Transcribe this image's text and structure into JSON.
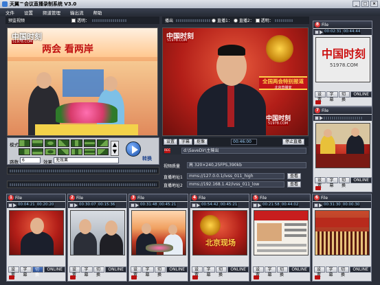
{
  "window": {
    "title": "天翼™会议直播录制系统 V3.0"
  },
  "menu": [
    "文件",
    "设置",
    "频道管理",
    "输出流",
    "帮助"
  ],
  "preview_bar": {
    "label": "预监视频",
    "transparency_label": "透明："
  },
  "output_bar": {
    "label": "播出",
    "live1": "直播1：",
    "live2": "直播2：",
    "transparency_label": "透明："
  },
  "preview_video": {
    "channel_logo": "中国时刻",
    "channel_url": "51978.COM",
    "caption": "两会 看两岸"
  },
  "transition": {
    "mode_label": "模式",
    "route_label": "路数",
    "route_value": "6",
    "effect_label": "效果",
    "effect_value": "无效果",
    "switch_label": "转换"
  },
  "program": {
    "channel_logo": "中国时刻",
    "channel_url": "51978.COM",
    "banner": "全国两会特别报道",
    "banner_sub": "北京直播室",
    "buttons": [
      "设置",
      "字幕",
      "抠像"
    ],
    "timecode": "00:46:00",
    "stop_label": "停止直播",
    "rec_label": "REC",
    "save_path": "d:\\SaveDir\\主输出",
    "quality_label": "视频质量",
    "quality_value": "高 320×240,25FPS,390kb",
    "live_addr1_label": "直播地址1",
    "live_addr1": "mms://127.0.0.1/ivss_011_high",
    "live_addr2_label": "直播地址2",
    "live_addr2": "mms://192.168.1.42/ivss_011_low",
    "view_label": "查看"
  },
  "right_cams": [
    {
      "num": "8",
      "label": "File",
      "t1": "00:02:31",
      "t2": "00:44:44",
      "logo": "中国时刻",
      "url": "51978.COM"
    },
    {
      "num": "7",
      "label": "File",
      "t1": "",
      "t2": "",
      "logo": "",
      "url": ""
    }
  ],
  "bottom_cams": [
    {
      "num": "1",
      "label": "File",
      "t1": "00:04:21",
      "t2": "00:20:20"
    },
    {
      "num": "2",
      "label": "File",
      "t1": "00:30:07",
      "t2": "00:15:36"
    },
    {
      "num": "3",
      "label": "File",
      "t1": "00:31:48",
      "t2": "00:45:21"
    },
    {
      "num": "4",
      "label": "File",
      "t1": "00:54:42",
      "t2": "00:45:21"
    },
    {
      "num": "5",
      "label": "File",
      "t1": "00:21:58",
      "t2": "00:44:02"
    },
    {
      "num": "6",
      "label": "File",
      "t1": "00:31:30",
      "t2": "00:00:30"
    }
  ],
  "cam_buttons": [
    "设置",
    "字幕",
    "切换",
    "ONLINE"
  ],
  "cam4_caption": "北京现场",
  "colors": {
    "accent": "#2a4d8f",
    "rec": "#bb1111",
    "studio_red": "#b21e18"
  }
}
